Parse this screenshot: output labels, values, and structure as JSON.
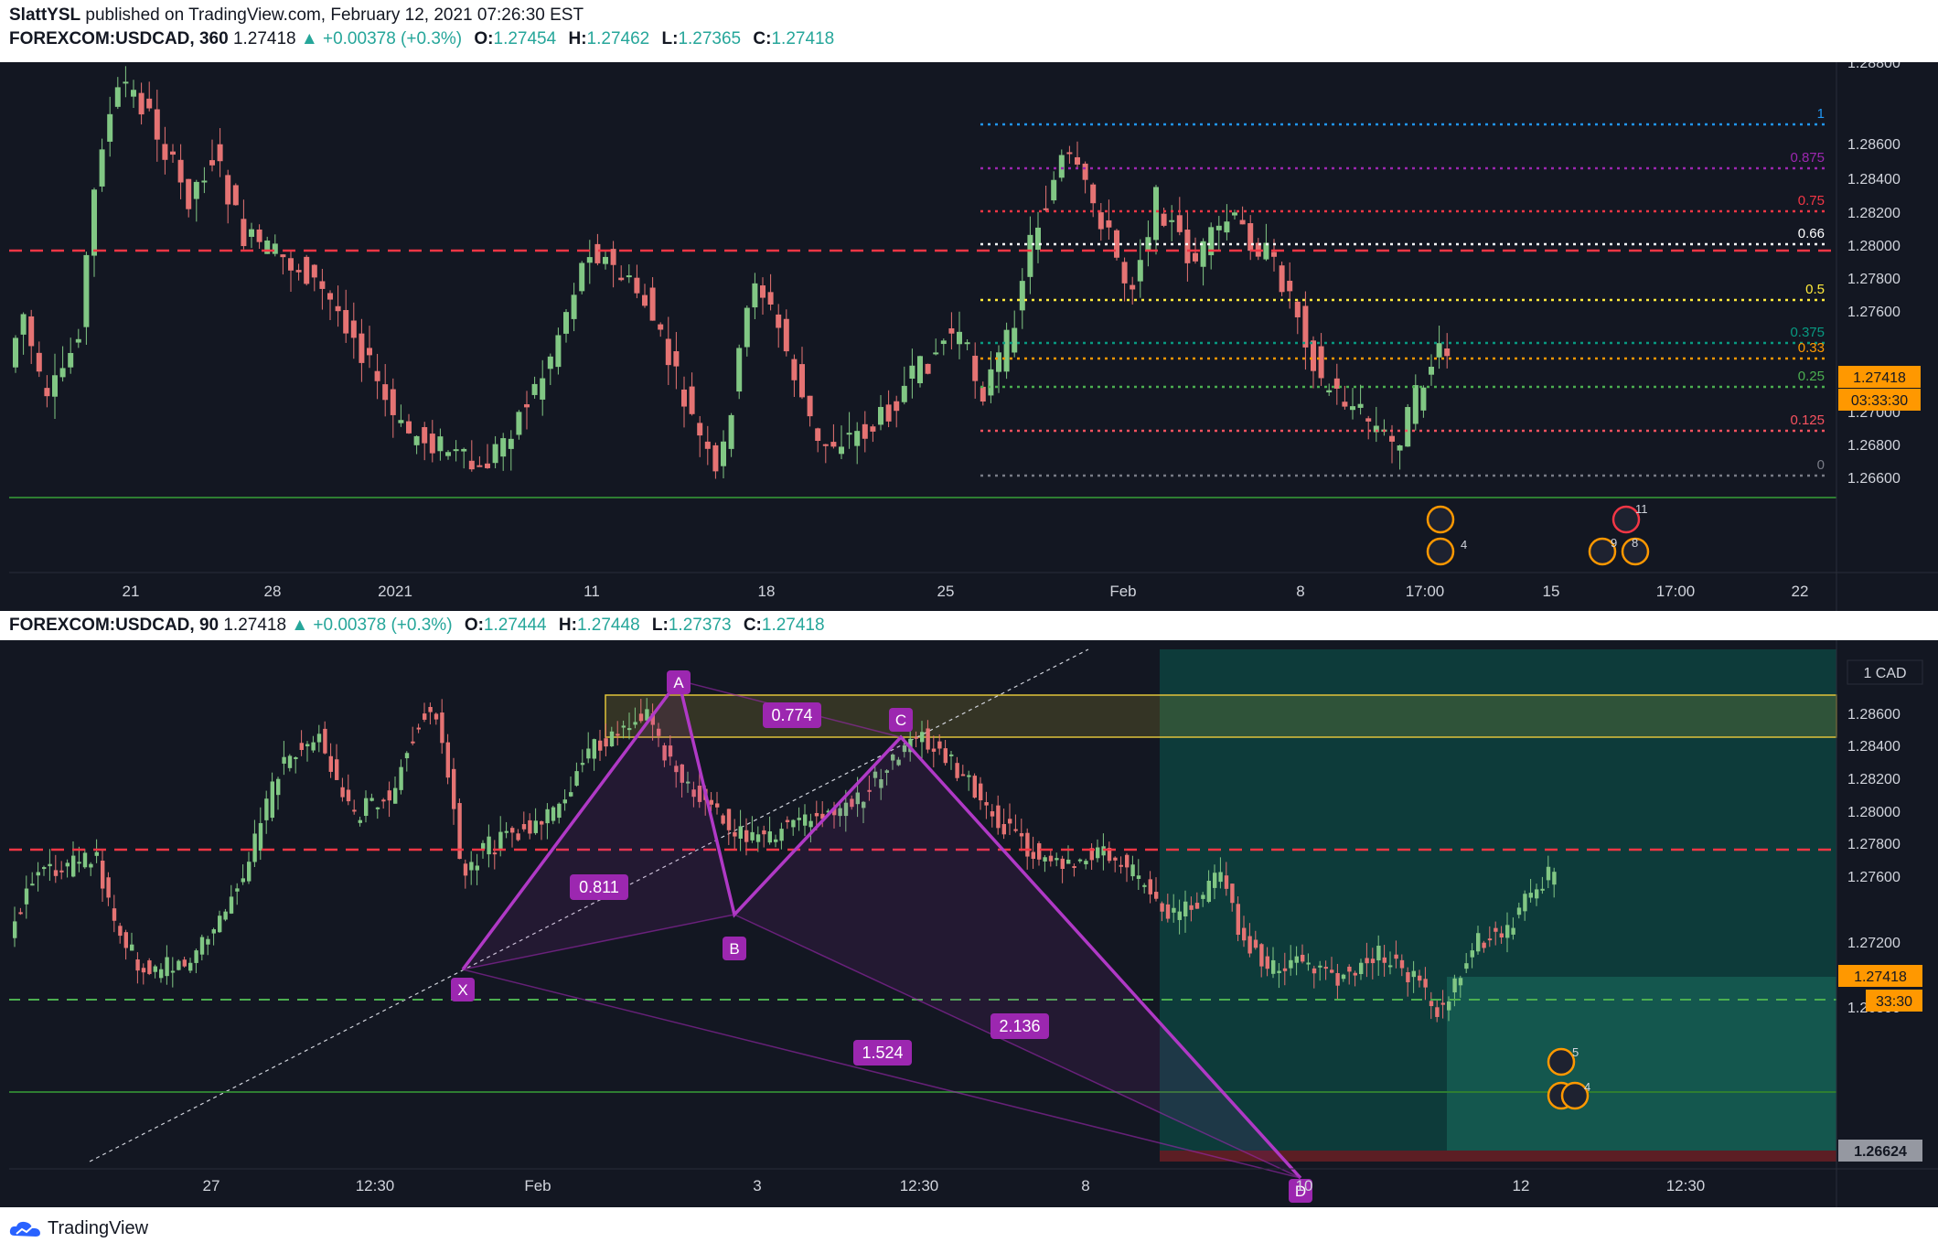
{
  "publish": {
    "author": "SlattYSL",
    "text": " published on TradingView.com, February 12, 2021 07:26:30 EST"
  },
  "top": {
    "symbol": "FOREXCOM:USDCAD, 360",
    "price": "1.27418",
    "change": "▲ +0.00378 (+0.3%)",
    "o": "1.27454",
    "h": "1.27462",
    "l": "1.27365",
    "c": "1.27418",
    "o_label": "O:",
    "h_label": "H:",
    "l_label": "L:",
    "c_label": "C:",
    "y_ticks": [
      "1.28800",
      "1.28600",
      "1.28400",
      "1.28200",
      "1.28000",
      "1.27800",
      "1.27600",
      "1.27200",
      "1.27000",
      "1.26800",
      "1.26600"
    ],
    "x_ticks": [
      "21",
      "28",
      "2021",
      "11",
      "18",
      "25",
      "Feb",
      "8",
      "17:00",
      "15",
      "17:00",
      "22"
    ],
    "fib_levels": [
      {
        "label": "1",
        "color": "#2196f3"
      },
      {
        "label": "0.875",
        "color": "#9c27b0"
      },
      {
        "label": "0.75",
        "color": "#f23645"
      },
      {
        "label": "0.66",
        "color": "#ffffff"
      },
      {
        "label": "0.5",
        "color": "#ffeb3b"
      },
      {
        "label": "0.375",
        "color": "#089981"
      },
      {
        "label": "0.33",
        "color": "#ff9800"
      },
      {
        "label": "0.25",
        "color": "#4caf50"
      },
      {
        "label": "0.125",
        "color": "#f7525f"
      },
      {
        "label": "0",
        "color": "#787b86"
      }
    ],
    "price_tag": "1.27418",
    "countdown": "03:33:30",
    "event_counts": [
      "4",
      "11",
      "9",
      "8"
    ]
  },
  "bottom": {
    "symbol": "FOREXCOM:USDCAD, 90",
    "price": "1.27418",
    "change": "▲ +0.00378 (+0.3%)",
    "o": "1.27444",
    "h": "1.27448",
    "l": "1.27373",
    "c": "1.27418",
    "o_label": "O:",
    "h_label": "H:",
    "l_label": "L:",
    "c_label": "C:",
    "currency": "1 CAD",
    "y_ticks": [
      "1.28600",
      "1.28400",
      "1.28200",
      "1.28000",
      "1.27800",
      "1.27600",
      "1.27200",
      "1.27000",
      "1.26800"
    ],
    "x_ticks": [
      "27",
      "12:30",
      "Feb",
      "3",
      "12:30",
      "8",
      "10",
      "12",
      "12:30"
    ],
    "points": [
      "X",
      "A",
      "B",
      "C",
      "D"
    ],
    "ratios": [
      "0.774",
      "0.811",
      "2.136",
      "1.524"
    ],
    "price_tag": "1.27418",
    "countdown": "33:30",
    "low_tag": "1.26624",
    "event_counts": [
      "5",
      "4"
    ]
  },
  "footer": {
    "brand": "TradingView"
  },
  "colors": {
    "bg": "#131722",
    "up": "#81c784",
    "down": "#e57373",
    "pattern": "#9c27b0",
    "accent": "#ff9800"
  }
}
